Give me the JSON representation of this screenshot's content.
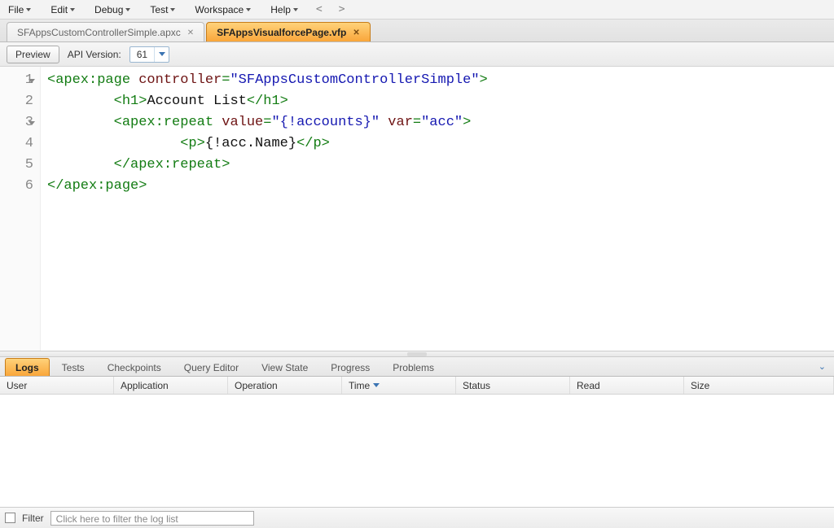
{
  "menubar": {
    "items": [
      "File",
      "Edit",
      "Debug",
      "Test",
      "Workspace",
      "Help"
    ],
    "nav_back": "<",
    "nav_fwd": ">"
  },
  "file_tabs": [
    {
      "label": "SFAppsCustomControllerSimple.apxc",
      "active": false
    },
    {
      "label": "SFAppsVisualforcePage.vfp",
      "active": true
    }
  ],
  "toolbar": {
    "preview_label": "Preview",
    "api_label": "API Version:",
    "api_version": "61"
  },
  "editor": {
    "lines": [
      {
        "n": "1",
        "fold": true,
        "ind": 0,
        "segs": [
          {
            "c": "tag",
            "t": "<apex:page"
          },
          {
            "c": "txt",
            "t": " "
          },
          {
            "c": "attr",
            "t": "controller"
          },
          {
            "c": "tag",
            "t": "="
          },
          {
            "c": "str",
            "t": "\"SFAppsCustomControllerSimple\""
          },
          {
            "c": "tag",
            "t": ">"
          }
        ]
      },
      {
        "n": "2",
        "fold": false,
        "ind": 2,
        "segs": [
          {
            "c": "tag",
            "t": "<h1>"
          },
          {
            "c": "txt",
            "t": "Account List"
          },
          {
            "c": "tag",
            "t": "</h1>"
          }
        ]
      },
      {
        "n": "3",
        "fold": true,
        "ind": 2,
        "segs": [
          {
            "c": "tag",
            "t": "<apex:repeat"
          },
          {
            "c": "txt",
            "t": " "
          },
          {
            "c": "attr",
            "t": "value"
          },
          {
            "c": "tag",
            "t": "="
          },
          {
            "c": "str",
            "t": "\"{!accounts}\""
          },
          {
            "c": "txt",
            "t": " "
          },
          {
            "c": "attr",
            "t": "var"
          },
          {
            "c": "tag",
            "t": "="
          },
          {
            "c": "str",
            "t": "\"acc\""
          },
          {
            "c": "tag",
            "t": ">"
          }
        ]
      },
      {
        "n": "4",
        "fold": false,
        "ind": 4,
        "segs": [
          {
            "c": "tag",
            "t": "<p>"
          },
          {
            "c": "txt",
            "t": "{!acc.Name}"
          },
          {
            "c": "tag",
            "t": "</p>"
          }
        ]
      },
      {
        "n": "5",
        "fold": false,
        "ind": 2,
        "segs": [
          {
            "c": "tag",
            "t": "</apex:repeat>"
          }
        ]
      },
      {
        "n": "6",
        "fold": false,
        "ind": 0,
        "segs": [
          {
            "c": "tag",
            "t": "</apex:page>"
          }
        ]
      }
    ]
  },
  "bottom_tabs": [
    "Logs",
    "Tests",
    "Checkpoints",
    "Query Editor",
    "View State",
    "Progress",
    "Problems"
  ],
  "bottom_active_tab": "Logs",
  "grid_columns": [
    "User",
    "Application",
    "Operation",
    "Time",
    "Status",
    "Read",
    "Size"
  ],
  "grid_sort_column": "Time",
  "filter": {
    "label": "Filter",
    "placeholder": "Click here to filter the log list"
  }
}
